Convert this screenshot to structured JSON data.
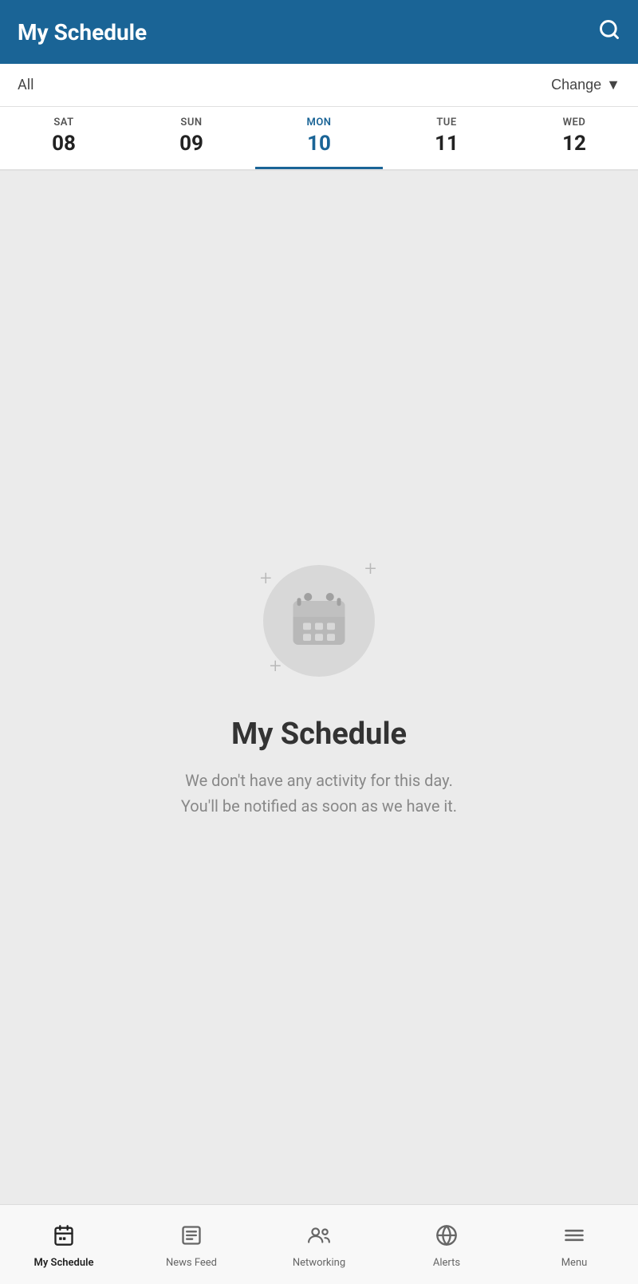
{
  "header": {
    "title": "My Schedule",
    "search_icon": "🔍"
  },
  "filter": {
    "all_label": "All",
    "change_label": "Change",
    "change_icon": "▼"
  },
  "days": [
    {
      "id": "sat",
      "name": "SAT",
      "number": "08",
      "active": false
    },
    {
      "id": "sun",
      "name": "SUN",
      "number": "09",
      "active": false
    },
    {
      "id": "mon",
      "name": "MON",
      "number": "10",
      "active": true
    },
    {
      "id": "tue",
      "name": "TUE",
      "number": "11",
      "active": false
    },
    {
      "id": "wed",
      "name": "WED",
      "number": "12",
      "active": false
    }
  ],
  "empty_state": {
    "title": "My Schedule",
    "subtitle_line1": "We don't have any activity for this day.",
    "subtitle_line2": "You'll be notified as soon as we have it."
  },
  "bottom_nav": [
    {
      "id": "my-schedule",
      "label": "My Schedule",
      "icon": "calendar",
      "active": true
    },
    {
      "id": "news-feed",
      "label": "News Feed",
      "icon": "news",
      "active": false
    },
    {
      "id": "networking",
      "label": "Networking",
      "icon": "people",
      "active": false
    },
    {
      "id": "alerts",
      "label": "Alerts",
      "icon": "globe",
      "active": false
    },
    {
      "id": "menu",
      "label": "Menu",
      "icon": "menu",
      "active": false
    }
  ],
  "colors": {
    "header_bg": "#1a6496",
    "active_tab": "#1a6496",
    "empty_icon_bg": "#d8d8d8",
    "empty_icon_color": "#b0b0b0"
  }
}
